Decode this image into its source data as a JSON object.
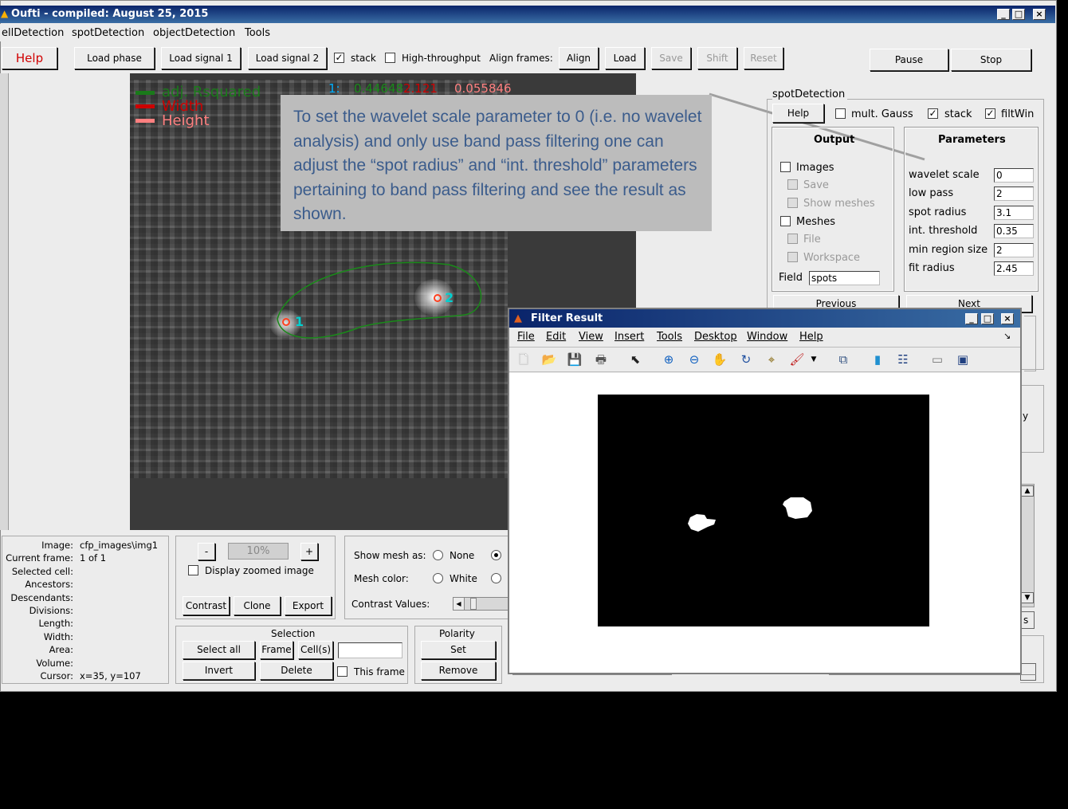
{
  "window": {
    "title": "Oufti - compiled:  August 25, 2015"
  },
  "menu": [
    "ellDetection",
    "spotDetection",
    "objectDetection",
    "Tools"
  ],
  "toolbar": {
    "help": "Help",
    "load_phase": "Load phase",
    "load_signal1": "Load signal 1",
    "load_signal2": "Load signal 2",
    "stack_label": "stack",
    "high_throughput_label": "High-throughput",
    "align_frames_label": "Align frames:",
    "align": "Align",
    "load": "Load",
    "save": "Save",
    "shift": "Shift",
    "reset": "Reset",
    "pause": "Pause",
    "stop": "Stop"
  },
  "plot": {
    "legend": [
      "adj. Rsquared",
      "Width",
      "Height"
    ],
    "legend_colors": [
      "#1a7a1a",
      "#cc0000",
      "#ff8080"
    ],
    "stats_index": "1:",
    "stats_v1": "0.44648",
    "stats_v2": "2.121",
    "stats_v3": "0.055846",
    "spot1": "1",
    "spot2": "2"
  },
  "annotation": {
    "text": "To set the wavelet scale parameter to 0 (i.e. no wavelet analysis) and only use band pass filtering one can adjust the “spot radius” and “int. threshold” parameters  pertaining to band pass filtering and see the result as shown."
  },
  "spot_panel": {
    "title": "spotDetection",
    "help": "Help",
    "mult_gauss": "mult. Gauss",
    "stack": "stack",
    "filtwin": "filtWin",
    "output_title": "Output",
    "images": "Images",
    "save": "Save",
    "show_meshes": "Show meshes",
    "meshes": "Meshes",
    "file": "File",
    "workspace": "Workspace",
    "field_label": "Field",
    "field_value": "spots",
    "params_title": "Parameters",
    "params": [
      {
        "label": "wavelet scale",
        "value": "0"
      },
      {
        "label": "low pass",
        "value": "2"
      },
      {
        "label": "spot radius",
        "value": "3.1"
      },
      {
        "label": "int. threshold",
        "value": "0.35"
      },
      {
        "label": "min region size",
        "value": "2"
      },
      {
        "label": "fit radius",
        "value": "2.45"
      }
    ],
    "previous": "Previous",
    "next": "Next",
    "partial_y": "y",
    "partial_s": "s"
  },
  "info": {
    "keys": [
      "Image:",
      "Current frame:",
      "Selected cell:",
      "Ancestors:",
      "Descendants:",
      "Divisions:",
      "Length:",
      "Width:",
      "Area:",
      "Volume:",
      "Cursor:"
    ],
    "values": [
      "cfp_images\\img1",
      "1 of 1",
      "",
      "",
      "",
      "",
      "",
      "",
      "",
      "",
      "x=35, y=107"
    ]
  },
  "zoom": {
    "minus": "-",
    "value": "10%",
    "plus": "+",
    "display_zoomed": "Display zoomed image",
    "contrast": "Contrast",
    "clone": "Clone",
    "export": "Export"
  },
  "mesh": {
    "show_mesh_as": "Show mesh as:",
    "none": "None",
    "mesh_color": "Mesh color:",
    "white": "White",
    "contrast_values": "Contrast Values:"
  },
  "selection": {
    "title": "Selection",
    "select_all": "Select all",
    "frame": "Frame",
    "cells": "Cell(s)",
    "invert": "Invert",
    "delete": "Delete",
    "this_frame": "This frame"
  },
  "polarity": {
    "title": "Polarity",
    "set": "Set",
    "remove": "Remove"
  },
  "filter_window": {
    "title": "Filter Result",
    "menu": [
      "File",
      "Edit",
      "View",
      "Insert",
      "Tools",
      "Desktop",
      "Window",
      "Help"
    ]
  }
}
